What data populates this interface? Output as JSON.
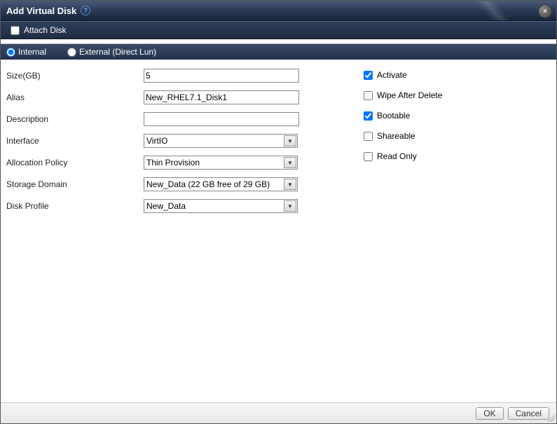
{
  "header": {
    "title": "Add Virtual Disk",
    "help_tooltip": "?",
    "close_tooltip": "×"
  },
  "subbar": {
    "attach_disk_label": "Attach Disk",
    "attach_disk_checked": false
  },
  "tabs": {
    "internal_label": "Internal",
    "external_label": "External (Direct Lun)",
    "selected": "internal"
  },
  "form": {
    "size": {
      "label": "Size(GB)",
      "value": "5"
    },
    "alias": {
      "label": "Alias",
      "value": "New_RHEL7.1_Disk1"
    },
    "description": {
      "label": "Description",
      "value": ""
    },
    "interface": {
      "label": "Interface",
      "selected": "VirtIO"
    },
    "allocation_policy": {
      "label": "Allocation Policy",
      "selected": "Thin Provision"
    },
    "storage_domain": {
      "label": "Storage Domain",
      "selected": "New_Data (22 GB free of 29 GB)"
    },
    "disk_profile": {
      "label": "Disk Profile",
      "selected": "New_Data"
    }
  },
  "checkboxes": {
    "activate": {
      "label": "Activate",
      "checked": true
    },
    "wipe_after_delete": {
      "label": "Wipe After Delete",
      "checked": false
    },
    "bootable": {
      "label": "Bootable",
      "checked": true
    },
    "shareable": {
      "label": "Shareable",
      "checked": false
    },
    "read_only": {
      "label": "Read Only",
      "checked": false
    }
  },
  "footer": {
    "ok_label": "OK",
    "cancel_label": "Cancel"
  }
}
